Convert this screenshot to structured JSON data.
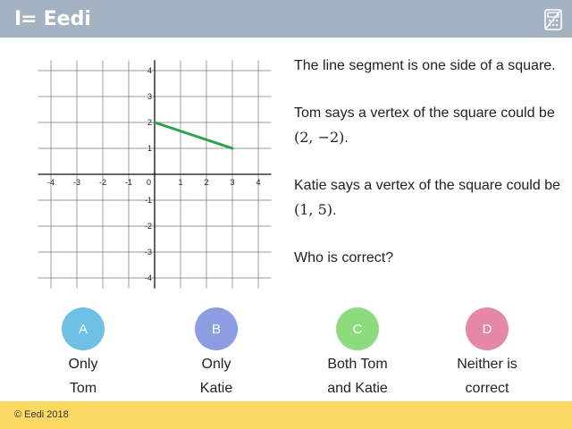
{
  "header": {
    "brand_mark": "I=",
    "brand_name": "Eedi"
  },
  "graph": {
    "x_ticks": [
      "-4",
      "-3",
      "-2",
      "-1",
      "1",
      "2",
      "3",
      "4"
    ],
    "y_ticks": [
      "4",
      "3",
      "2",
      "1",
      "-1",
      "-2",
      "-3",
      "-4"
    ],
    "origin_label": "0",
    "segment": {
      "from": [
        0,
        2
      ],
      "to": [
        3,
        1
      ],
      "color": "#2e9e4f"
    }
  },
  "question": {
    "line1": "The line segment is one side of a square.",
    "tom_text": "Tom says a vertex of the square could be ",
    "tom_point": "(2, −2)",
    "katie_text": "Katie says a vertex of the square could be ",
    "katie_point": "(1, 5)",
    "period": ".",
    "prompt": "Who is correct?"
  },
  "options": [
    {
      "letter": "A",
      "line1": "Only",
      "line2": "Tom",
      "color": "#6ec1e4"
    },
    {
      "letter": "B",
      "line1": "Only",
      "line2": "Katie",
      "color": "#8d9de2"
    },
    {
      "letter": "C",
      "line1": "Both Tom",
      "line2": "and Katie",
      "color": "#8ddb7c"
    },
    {
      "letter": "D",
      "line1": "Neither is",
      "line2": "correct",
      "color": "#e488a6"
    }
  ],
  "footer": {
    "copyright": "© Eedi 2018"
  }
}
